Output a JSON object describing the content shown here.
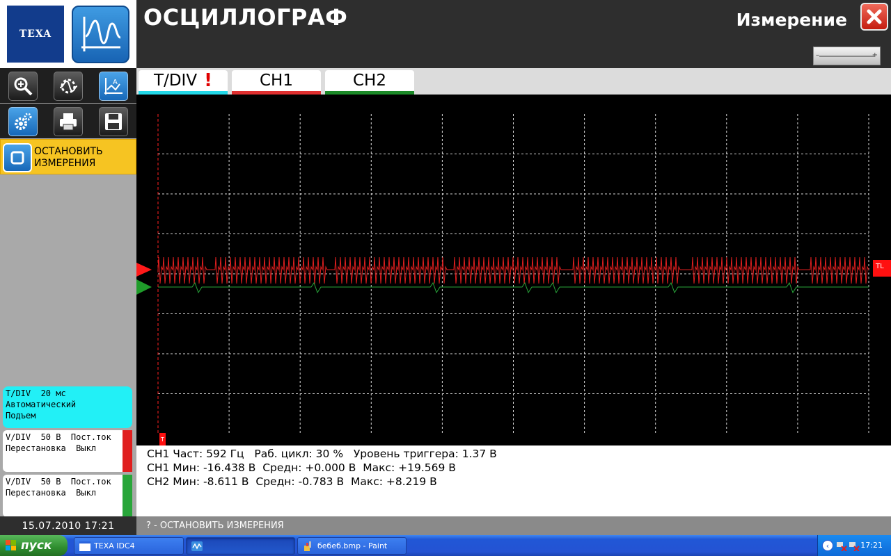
{
  "header": {
    "brand_logo": "TEXA",
    "app_title": "ОСЦИЛЛОГРАФ",
    "mode_label": "Измерение",
    "zoom_minus": "–",
    "zoom_plus": "+"
  },
  "toolbar": {
    "row1": [
      "zoom-icon",
      "auto-setup-icon",
      "cursor-measure-icon"
    ],
    "row2": [
      "settings-icon",
      "print-icon",
      "save-icon"
    ],
    "stop_line1": "ОСТАНОВИТЬ",
    "stop_line2": "ИЗМЕРЕНИЯ"
  },
  "channels": {
    "tdiv": "T/DIV  20 мс\nАвтоматический\nПодъем",
    "ch1": "V/DIV  50 В  Пост.ток\nПерестановка  Выкл",
    "ch2": "V/DIV  50 В  Пост.ток\nПерестановка  Выкл",
    "ch1_color": "#e01f1f",
    "ch2_color": "#28a63a"
  },
  "datetime": "15.07.2010  17:21",
  "tabs": [
    {
      "label": "T/DIV",
      "warn": "!"
    },
    {
      "label": "CH1"
    },
    {
      "label": "CH2"
    }
  ],
  "scope": {
    "trigger_label": "TL",
    "time_marker": "T"
  },
  "measurements": {
    "line1": "CH1 Част: 592 Гц   Раб. цикл: 30 %   Уровень триггера: 1.37 В",
    "line2": "CH1 Мин: -16.438 В  Средн: +0.000 В  Макс: +19.569 В",
    "line3": "CH2 Мин: -8.611 В  Средн: -0.783 В  Макс: +8.219 В"
  },
  "status_line": "? - ОСТАНОВИТЬ ИЗМЕРЕНИЯ",
  "taskbar": {
    "start": "пуск",
    "tasks": [
      {
        "label": "TEXA IDC4",
        "active": false
      },
      {
        "label": "",
        "active": true
      },
      {
        "label": "бебеб.bmp - Paint",
        "active": false
      }
    ],
    "clock": "17:21"
  }
}
